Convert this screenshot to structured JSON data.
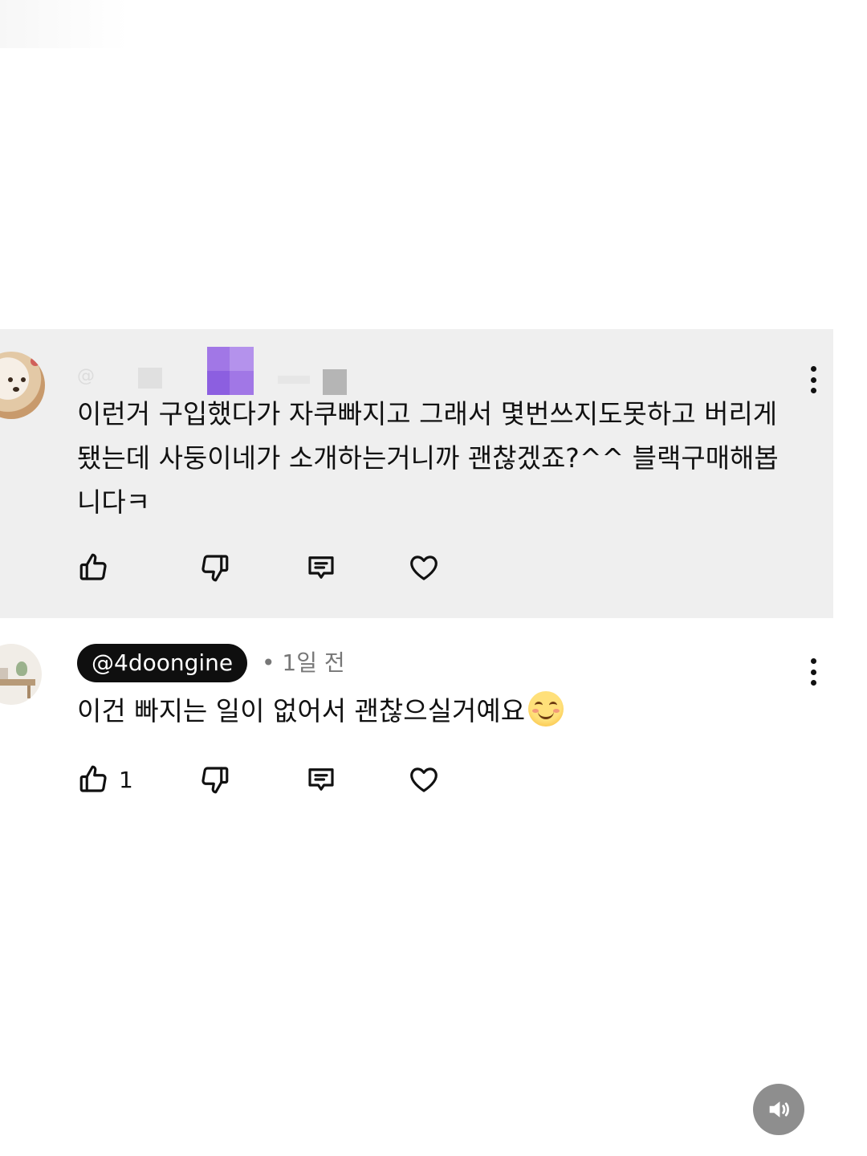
{
  "comments": [
    {
      "author_handle": "@",
      "author_blurred": true,
      "text": "이런거 구입했다가 자쿠빠지고 그래서 몇번쓰지도못하고 버리게됐는데 사둥이네가 소개하는거니까 괜찮겠죠?^^ 블랙구매해봅니다ㅋ",
      "like_count": "",
      "highlighted": true,
      "avatar_icon": "dog-avatar",
      "actions": [
        "thumbs-up-icon",
        "thumbs-down-icon",
        "reply-icon",
        "heart-icon"
      ]
    },
    {
      "author_handle": "@4doongine",
      "author_is_creator_pill": true,
      "separator": "•",
      "timestamp": "1일 전",
      "text": "이건 빠지는 일이 없어서 괜찮으실거예요",
      "emoji": "smiling-face-emoji",
      "like_count": "1",
      "avatar_icon": "room-avatar",
      "actions": [
        "thumbs-up-icon",
        "thumbs-down-icon",
        "reply-icon",
        "heart-icon"
      ]
    }
  ],
  "sound_button": {
    "icon": "speaker-icon",
    "color": "#8e8e8e"
  },
  "colors": {
    "highlight_bg": "#efefef",
    "text": "#111111",
    "meta": "#777777",
    "pill_bg": "#0f0f0f",
    "pill_text": "#ffffff",
    "blur_purple": "#a177e6"
  }
}
